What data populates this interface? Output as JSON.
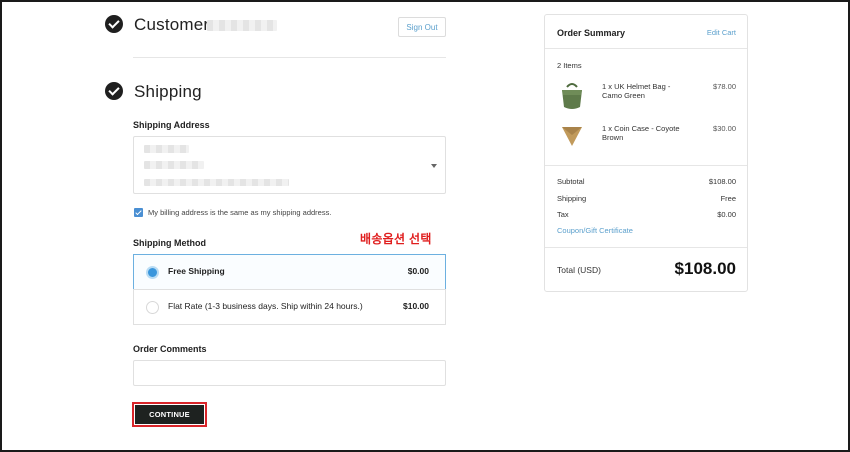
{
  "customer": {
    "title": "Customer",
    "signout_label": "Sign Out"
  },
  "shipping": {
    "title": "Shipping",
    "address_label": "Shipping Address",
    "billing_same_label": "My billing address is the same as my shipping address.",
    "method_label": "Shipping Method",
    "annotation": "배송옵션 선택",
    "options": [
      {
        "name": "Free Shipping",
        "price": "$0.00",
        "selected": true
      },
      {
        "name": "Flat Rate (1-3 business days. Ship within 24 hours.)",
        "price": "$10.00",
        "selected": false
      }
    ],
    "comments_label": "Order Comments",
    "continue_label": "CONTINUE"
  },
  "summary": {
    "title": "Order Summary",
    "edit_cart_label": "Edit Cart",
    "items_count": "2 Items",
    "items": [
      {
        "name": "1 x UK Helmet Bag - Camo Green",
        "price": "$78.00"
      },
      {
        "name": "1 x Coin Case - Coyote Brown",
        "price": "$30.00"
      }
    ],
    "subtotal_label": "Subtotal",
    "subtotal_value": "$108.00",
    "shipping_label": "Shipping",
    "shipping_value": "Free",
    "tax_label": "Tax",
    "tax_value": "$0.00",
    "coupon_label": "Coupon/Gift Certificate",
    "total_label": "Total (USD)",
    "total_value": "$108.00"
  },
  "colors": {
    "link": "#5a9fcc",
    "accent": "#3a96dc",
    "annotation": "#e01e1e",
    "button": "#1e2220"
  }
}
